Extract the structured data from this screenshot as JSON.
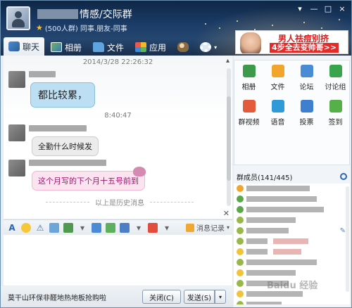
{
  "window": {
    "title": "情感/交际群",
    "subtitle": "(500人群) 同事.朋友-同事",
    "controls": [
      "▾",
      "—",
      "□",
      "×"
    ]
  },
  "ad_banner": {
    "line1": "男人祛痘别挤",
    "line2": "4步全去变帅哥>>"
  },
  "tabs": [
    {
      "label": "聊天",
      "icon": "chat-icon",
      "active": true
    },
    {
      "label": "相册",
      "icon": "photo-icon",
      "active": false
    },
    {
      "label": "文件",
      "icon": "folder-icon",
      "active": false
    },
    {
      "label": "应用",
      "icon": "apps-icon",
      "active": false
    }
  ],
  "chat": {
    "timestamp1": "2014/3/28 22:26:32",
    "timestamp2": "8:40:47",
    "messages": [
      {
        "text": "都比较累，"
      },
      {
        "text": "全勤什么时候发"
      },
      {
        "text": "这个月写的下个月十五号前到"
      }
    ],
    "history_label": "以上是历史消息"
  },
  "format_toolbar": {
    "record_label": "消息记录"
  },
  "bottom": {
    "ad_text": "莫干山环保非醛地热地板抢购啦",
    "close_label": "关闭(C)",
    "send_label": "发送(S)",
    "send_dropdown": "▾"
  },
  "apps": [
    {
      "label": "相册",
      "color": "#3d9a4a"
    },
    {
      "label": "文件",
      "color": "#f2a52c"
    },
    {
      "label": "论坛",
      "color": "#4a8bd6"
    },
    {
      "label": "讨论组",
      "color": "#3aa44c"
    },
    {
      "label": "群视频",
      "color": "#e45a3c"
    },
    {
      "label": "语音",
      "color": "#2f9ad8"
    },
    {
      "label": "投票",
      "color": "#3f7fd0"
    },
    {
      "label": "签到",
      "color": "#55b04a"
    }
  ],
  "members": {
    "title": "群成员(141/445)"
  },
  "watermark": "Baidu 经验"
}
